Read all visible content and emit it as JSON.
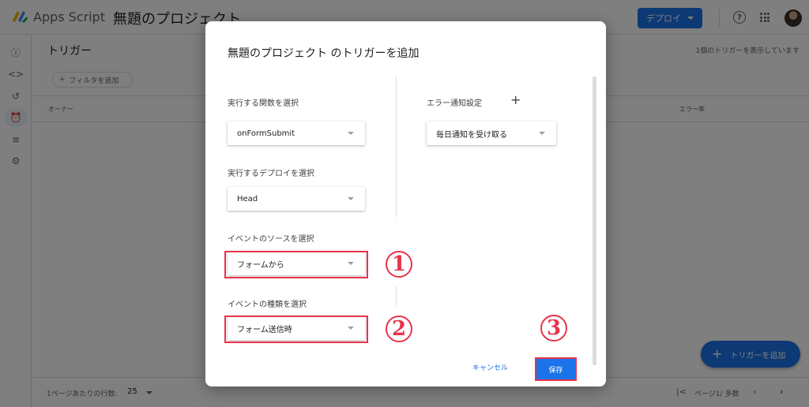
{
  "header": {
    "app_name": "Apps Script",
    "project_name": "無題のプロジェクト",
    "deploy_label": "デプロイ",
    "help_icon": "help-circle-icon",
    "apps_icon": "apps-grid-icon"
  },
  "sidebar": {
    "items": [
      {
        "name": "overview",
        "icon": "ⓘ"
      },
      {
        "name": "editor",
        "icon": "<>"
      },
      {
        "name": "executions",
        "icon": "↺"
      },
      {
        "name": "triggers",
        "icon": "⏰"
      },
      {
        "name": "executions-list",
        "icon": "≡"
      },
      {
        "name": "settings",
        "icon": "⚙"
      }
    ]
  },
  "main": {
    "title": "トリガー",
    "count_text": "1個のトリガーを表示しています",
    "filter_label": "フィルタを追加",
    "columns": {
      "owner": "オーナー",
      "error_rate": "エラー率"
    },
    "footer": {
      "rows_label": "1ページあたりの行数:",
      "rows_value": "25",
      "page_label": "ページ1/ 多数"
    },
    "add_trigger_label": "トリガーを追加"
  },
  "dialog": {
    "title": "無題のプロジェクト のトリガーを追加",
    "function_label": "実行する関数を選択",
    "function_value": "onFormSubmit",
    "deployment_label": "実行するデプロイを選択",
    "deployment_value": "Head",
    "source_label": "イベントのソースを選択",
    "source_value": "フォームから",
    "type_label": "イベントの種類を選択",
    "type_value": "フォーム送信時",
    "notify_label": "エラー通知設定",
    "notify_value": "毎日通知を受け取る",
    "cancel_label": "キャンセル",
    "save_label": "保存"
  },
  "annotations": {
    "marker1": "1",
    "marker2": "2",
    "marker3": "3",
    "color": "#e8334a"
  },
  "colors": {
    "accent": "#1a73e8"
  }
}
